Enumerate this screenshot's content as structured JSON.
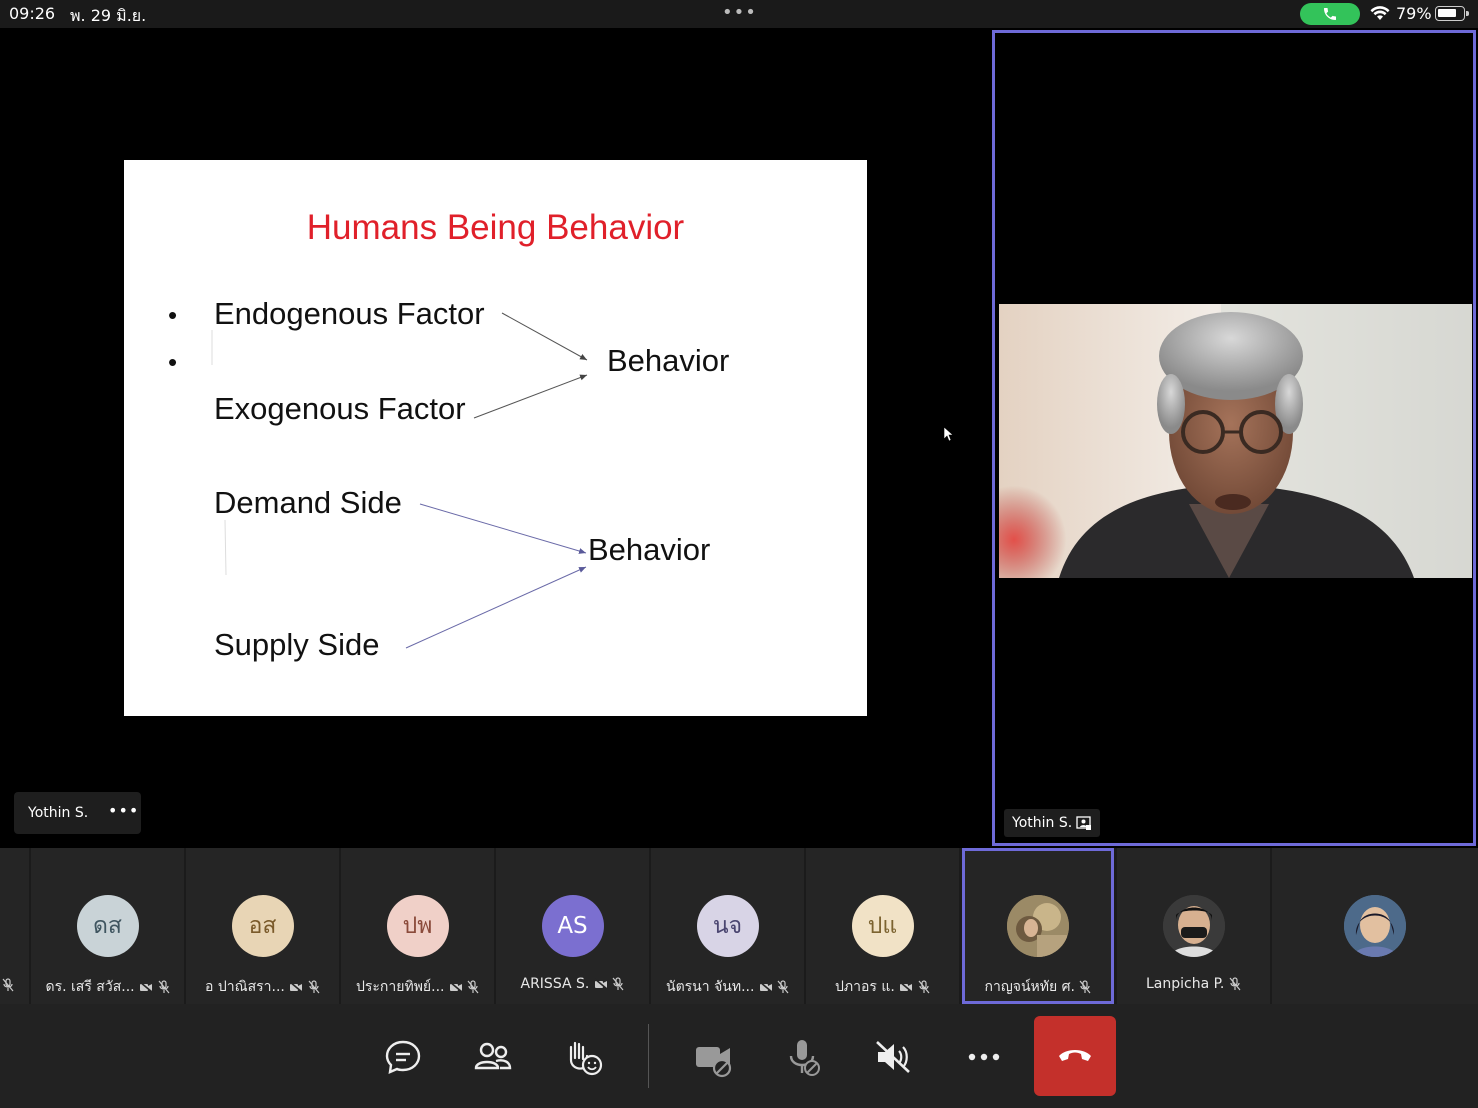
{
  "status_bar": {
    "time": "09:26",
    "date": "พ. 29 มิ.ย.",
    "battery_percent": "79%",
    "battery_level": 0.79,
    "call_active_color": "#33c35a"
  },
  "top_dots": "•••",
  "slide": {
    "title": "Humans Being Behavior",
    "title_color": "#e0202a",
    "bullets": [
      "•",
      "•"
    ],
    "factors": [
      "Endogenous Factor",
      "Exogenous Factor"
    ],
    "behavior_1": "Behavior",
    "sides": [
      "Demand Side",
      "Supply Side"
    ],
    "behavior_2": "Behavior"
  },
  "sharer": {
    "name": "Yothin S.",
    "more": "•••"
  },
  "video_panel": {
    "name": "Yothin S.",
    "border_color": "#6e6ad8"
  },
  "participants": [
    {
      "initials": "ดส",
      "name": "ดร. เสรี สวัส...",
      "bg": "#c9d3d7",
      "fg": "#3f5560",
      "icons": [
        "video-off-icon",
        "mic-off-icon"
      ]
    },
    {
      "initials": "อส",
      "name": "อ ปาณิสรา...",
      "bg": "#e8d5b5",
      "fg": "#7a5a2a",
      "icons": [
        "video-off-icon",
        "mic-off-icon"
      ]
    },
    {
      "initials": "ปพ",
      "name": "ประกายทิพย์...",
      "bg": "#f0d0c8",
      "fg": "#8a4a3a",
      "icons": [
        "video-off-icon",
        "mic-off-icon"
      ]
    },
    {
      "initials": "AS",
      "name": "ARISSA S.",
      "bg": "#7b6fd0",
      "fg": "#ffffff",
      "icons": [
        "video-off-icon",
        "mic-off-icon"
      ]
    },
    {
      "initials": "นจ",
      "name": "นัตรนา จันท...",
      "bg": "#d8d4e6",
      "fg": "#4a4570",
      "icons": [
        "video-off-icon",
        "mic-off-icon"
      ]
    },
    {
      "initials": "ปแ",
      "name": "ปภาอร แ.",
      "bg": "#f1e2c6",
      "fg": "#7c6330",
      "icons": [
        "video-off-icon",
        "mic-off-icon"
      ]
    },
    {
      "initials": "",
      "name": "กาญจน์หทัย ศ.",
      "bg": "#8c7a5c",
      "fg": "#ffffff",
      "icons": [
        "mic-off-icon"
      ],
      "active": true
    },
    {
      "initials": "",
      "name": "Lanpicha P.",
      "bg": "#3a3a3a",
      "fg": "#ffffff",
      "icons": [
        "mic-off-icon"
      ]
    },
    {
      "initials": "",
      "name": "",
      "bg": "#4d6a8a",
      "fg": "#ffffff",
      "icons": []
    }
  ],
  "controls": {
    "icons": [
      "chat-icon",
      "people-icon",
      "reactions-icon",
      "camera-off-icon",
      "mic-off-icon",
      "speaker-off-icon",
      "more-icon",
      "hang-up-icon"
    ],
    "hangup_color": "#c4302b"
  }
}
